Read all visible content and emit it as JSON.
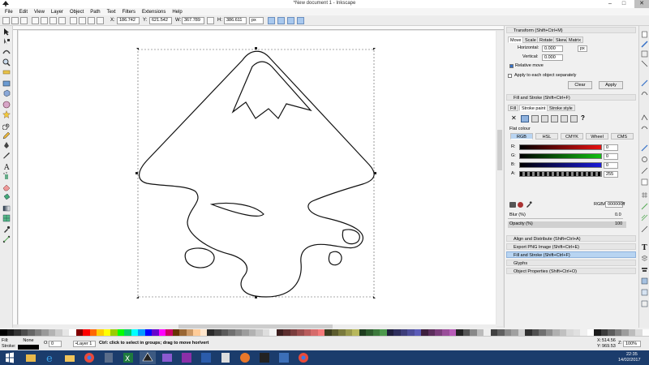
{
  "window": {
    "title": "*New document 1 - Inkscape",
    "minimize": "–",
    "maximize": "□",
    "close": "✕"
  },
  "menu": [
    "File",
    "Edit",
    "View",
    "Layer",
    "Object",
    "Path",
    "Text",
    "Filters",
    "Extensions",
    "Help"
  ],
  "toolbar": {
    "x_label": "X:",
    "x_value": "186.742",
    "y_label": "Y:",
    "y_value": "621.542",
    "w_label": "W:",
    "w_value": "367.789",
    "h_label": "H:",
    "h_value": "386.611",
    "unit": "px"
  },
  "transform": {
    "header": "Transform (Shift+Ctrl+M)",
    "tabs": [
      "Move",
      "Scale",
      "Rotate",
      "Skew",
      "Matrix"
    ],
    "horizontal_label": "Horizontal:",
    "horizontal_value": "0.000",
    "vertical_label": "Vertical:",
    "vertical_value": "0.000",
    "unit": "px",
    "relative_move": "Relative move",
    "apply_each": "Apply to each object separately",
    "clear_btn": "Clear",
    "apply_btn": "Apply"
  },
  "fill_stroke": {
    "header": "Fill and Stroke (Shift+Ctrl+F)",
    "tabs": [
      "Fill",
      "Stroke paint",
      "Stroke style"
    ],
    "paint_q": "?",
    "flat_colour": "Flat colour",
    "modes": [
      "RGB",
      "HSL",
      "CMYK",
      "Wheel",
      "CMS"
    ],
    "channels": [
      {
        "label": "R:",
        "value": "0",
        "color": "#e81010"
      },
      {
        "label": "G:",
        "value": "0",
        "color": "#12c012"
      },
      {
        "label": "B:",
        "value": "0",
        "color": "#1a1ad8"
      },
      {
        "label": "A:",
        "value": "255",
        "color": "#000000"
      }
    ],
    "rgba_label": "RGBA:",
    "rgba_value": "000000ff",
    "blur_label": "Blur (%)",
    "blur_value": "0.0",
    "opacity_label": "Opacity (%)",
    "opacity_value": "100"
  },
  "docks": [
    {
      "label": "Align and Distribute (Shift+Ctrl+A)",
      "active": false
    },
    {
      "label": "Export PNG Image (Shift+Ctrl+E)",
      "active": false
    },
    {
      "label": "Fill and Stroke (Shift+Ctrl+F)",
      "active": true
    },
    {
      "label": "Glyphs",
      "active": false
    },
    {
      "label": "Object Properties (Shift+Ctrl+O)",
      "active": false
    }
  ],
  "status": {
    "fill_label": "Fill:",
    "stroke_label": "Stroke:",
    "fill_value": "None",
    "opacity_label": "O:",
    "opacity_value": "0",
    "layer": "•Layer 1",
    "message": "Ctrl: click to select in groups; drag to move hor/vert",
    "x_label": "X:",
    "x_value": "514.56",
    "y_label": "Y:",
    "y_value": "969.53",
    "z_label": "Z:",
    "zoom_value": "100%"
  },
  "taskbar": {
    "time": "22:35",
    "date": "14/02/2017"
  },
  "palette": [
    "#000000",
    "#1a1a1a",
    "#333333",
    "#4d4d4d",
    "#666666",
    "#808080",
    "#999999",
    "#b3b3b3",
    "#cccccc",
    "#e6e6e6",
    "#ffffff",
    "#800000",
    "#ff0000",
    "#ff6600",
    "#ffcc00",
    "#ffff00",
    "#99cc00",
    "#00ff00",
    "#00cc66",
    "#00ffff",
    "#0099ff",
    "#0000ff",
    "#6600cc",
    "#ff00ff",
    "#cc0066",
    "#663300",
    "#996633",
    "#cc9966",
    "#ffcc99",
    "#ffe6cc",
    "#2b2b2b",
    "#444444",
    "#5a5a5a",
    "#707070",
    "#868686",
    "#9c9c9c",
    "#b2b2b2",
    "#c8c8c8",
    "#dedede",
    "#f4f4f4",
    "#3d1f1f",
    "#5c2e2e",
    "#7a3d3d",
    "#994d4d",
    "#b85c5c",
    "#d66b6b",
    "#f57a7a",
    "#3d3d1f",
    "#5c5c2e",
    "#7a7a3d",
    "#99994d",
    "#b8b85c",
    "#1f3d1f",
    "#2e5c2e",
    "#3d7a3d",
    "#4d994d",
    "#1f1f3d",
    "#2e2e5c",
    "#3d3d7a",
    "#4d4d99",
    "#5c5cb8",
    "#3d1f3d",
    "#5c2e5c",
    "#7a3d7a",
    "#994d99",
    "#b85cb8",
    "#222222",
    "#555555",
    "#888888",
    "#bbbbbb",
    "#eeeeee",
    "#404040",
    "#606060",
    "#8a8a8a",
    "#a0a0a0",
    "#d0d0d0",
    "#303030",
    "#505050",
    "#707070",
    "#909090",
    "#b0b0b0",
    "#c0c0c0",
    "#d8d8d8",
    "#e0e0e0",
    "#f0f0f0",
    "#ffffff",
    "#1c1c1c",
    "#3c3c3c",
    "#5c5c5c",
    "#7c7c7c",
    "#9c9c9c",
    "#bcbcbc",
    "#dcdcdc",
    "#fcfcfc"
  ]
}
